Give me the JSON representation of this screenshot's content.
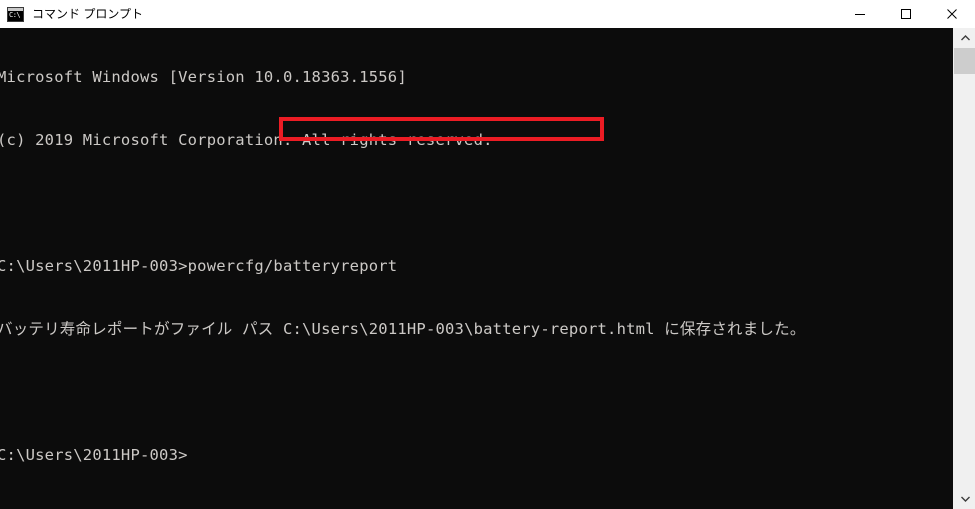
{
  "window": {
    "title": "コマンド プロンプト",
    "icon_name": "console-icon",
    "icon_prompt": "C:\\",
    "controls": {
      "minimize_label": "最小化",
      "maximize_label": "最大化",
      "close_label": "閉じる"
    }
  },
  "console": {
    "background_color": "#0c0c0c",
    "text_color": "#ccc9c6",
    "lines": [
      "Microsoft Windows [Version 10.0.18363.1556]",
      "(c) 2019 Microsoft Corporation. All rights reserved.",
      "",
      "C:\\Users\\2011HP-003>powercfg/batteryreport",
      "バッテリ寿命レポートがファイル パス C:\\Users\\2011HP-003\\battery-report.html に保存されました。",
      "",
      "C:\\Users\\2011HP-003>"
    ],
    "command": "powercfg/batteryreport",
    "prompt": "C:\\Users\\2011HP-003>",
    "message_prefix": "バッテリ寿命レポートがファイル パス ",
    "message_suffix": " に保存されました。",
    "report_path": "C:\\Users\\2011HP-003\\battery-report.html"
  },
  "annotation": {
    "highlight_color": "#ec1c24",
    "highlight_target": "C:\\Users\\2011HP-003\\battery-report.html"
  },
  "scrollbar": {
    "up_arrow": "chevron-up-icon",
    "down_arrow": "chevron-down-icon",
    "thumb_color": "#cdcdcd",
    "track_color": "#f0f0f0"
  }
}
